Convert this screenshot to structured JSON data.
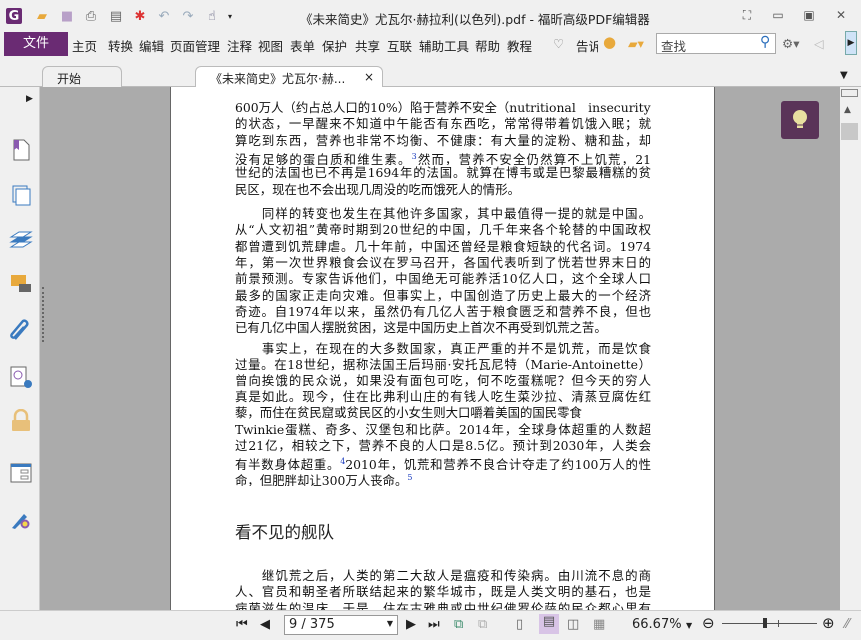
{
  "window": {
    "title": "《未来简史》尤瓦尔·赫拉利(以色列).pdf - 福昕高级PDF编辑器"
  },
  "menu": {
    "file": "文件",
    "items": [
      "主页",
      "转换",
      "编辑",
      "页面管理",
      "注释",
      "视图",
      "表单",
      "保护",
      "共享",
      "互联",
      "辅助工具",
      "帮助",
      "教程"
    ],
    "tell": "告诉",
    "search_placeholder": "查找"
  },
  "tabs": [
    {
      "label": "开始"
    },
    {
      "label": "《未来简史》尤瓦尔·赫...",
      "close": "×"
    }
  ],
  "document": {
    "p1": [
      "600万人（约占总人口的10%）陷于营养不安全（nutritional　insecurity）",
      "的状态，一早醒来不知道中午能否有东西吃，常常得带着饥饿入眠；就",
      "算吃到东西，营养也非常不均衡、不健康：有大量的淀粉、糖和盐，却",
      "没有足够的蛋白质和维生素。",
      "世纪的法国也已不再是1694年的法国。就算在博韦或是巴黎最糟糕的贫",
      "民区，现在也不会出现几周没的吃而饿死人的情形。"
    ],
    "p1_line4_rest": "然而，营养不安全仍然算不上饥荒，21",
    "fn3": "3",
    "p2": [
      "　　同样的转变也发生在其他许多国家，其中最值得一提的就是中国。",
      "从“人文初祖”黄帝时期到20世纪的中国，几千年来各个轮替的中国政权",
      "都曾遭到饥荒肆虐。几十年前，中国还曾经是粮食短缺的代名词。1974",
      "年，第一次世界粮食会议在罗马召开，各国代表听到了恍若世界末日的",
      "前景预测。专家告诉他们，中国绝无可能养活10亿人口，这个全球人口",
      "最多的国家正走向灾难。但事实上，中国创造了历史上最大的一个经济",
      "奇迹。自1974年以来，虽然仍有几亿人苦于粮食匮乏和营养不良，但也",
      "已有几亿中国人摆脱贫困，这是中国历史上首次不再受到饥荒之苦。"
    ],
    "p3": [
      "　　事实上，在现在的大多数国家，真正严重的并不是饥荒，而是饮食",
      "过量。在18世纪，据称法国王后玛丽·安托瓦尼特（Marie-Antoinette）",
      "曾向挨饿的民众说，如果没有面包可吃，何不吃蛋糕呢？但今天的穷人",
      "真是如此。现今，住在比弗利山庄的有钱人吃生菜沙拉、清蒸豆腐佐红",
      "藜，而住在贫民窟或贫民区的小女生则大口嚼着美国的国民零食",
      "Twinkie蛋糕、奇多、汉堡包和比萨。2014年，全球身体超重的人数超",
      "过21亿，相较之下，营养不良的人口是8.5亿。预计到2030年，人类会",
      "有半数身体超重。",
      "命，但肥胖却让300万人丧命。"
    ],
    "p3_line8_rest": "2010年，饥荒和营养不良合计夺走了约100万人的性",
    "fn4": "4",
    "fn5": "5",
    "heading": "看不见的舰队",
    "p4": [
      "　　继饥荒之后，人类的第二大敌人是瘟疫和传染病。由川流不息的商",
      "人、官员和朝圣者所联结起来的繁华城市，既是人类文明的基石，也是",
      "病菌滋生的温床。于是，住在古雅典或中世纪佛罗伦萨的民众都心里有"
    ]
  },
  "status": {
    "page": "9 / 375",
    "zoom": "66.67%",
    "zoom_fraction": 0.45
  },
  "colors": {
    "accent": "#6a2b73",
    "tip_bg": "#5a3358"
  }
}
